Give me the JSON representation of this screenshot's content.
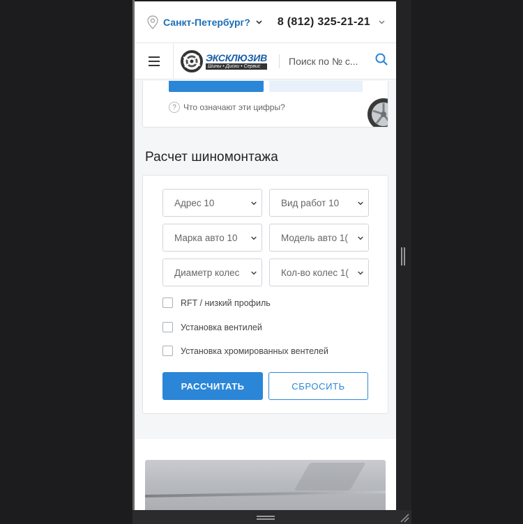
{
  "header": {
    "city": "Санкт-Петербург?",
    "phone": "8 (812) 325-21-21"
  },
  "nav": {
    "logo_main": "ЭКСКЛЮЗИВ",
    "logo_sub": "Шины • Диски • Сервис",
    "search_placeholder": "Поиск по № с..."
  },
  "prev_card": {
    "help_text": "Что означают эти цифры?"
  },
  "calc": {
    "title": "Расчет шиномонтажа",
    "selects": {
      "address": "Адрес 10",
      "work_type": "Вид работ 10",
      "car_brand": "Марка авто 10",
      "car_model": "Модель авто 1(",
      "diameter": "Диаметр колес",
      "wheel_count": "Кол-во колес 1("
    },
    "checkboxes": {
      "rft": "RFT / низкий профиль",
      "valves": "Установка вентилей",
      "chrome_valves": "Установка хромированных вентелей"
    },
    "calculate_label": "РАССЧИТАТЬ",
    "reset_label": "СБРОСИТЬ"
  },
  "colors": {
    "accent": "#2b86d8",
    "link": "#1a6fb8",
    "page_bg": "#f4f6f8"
  }
}
